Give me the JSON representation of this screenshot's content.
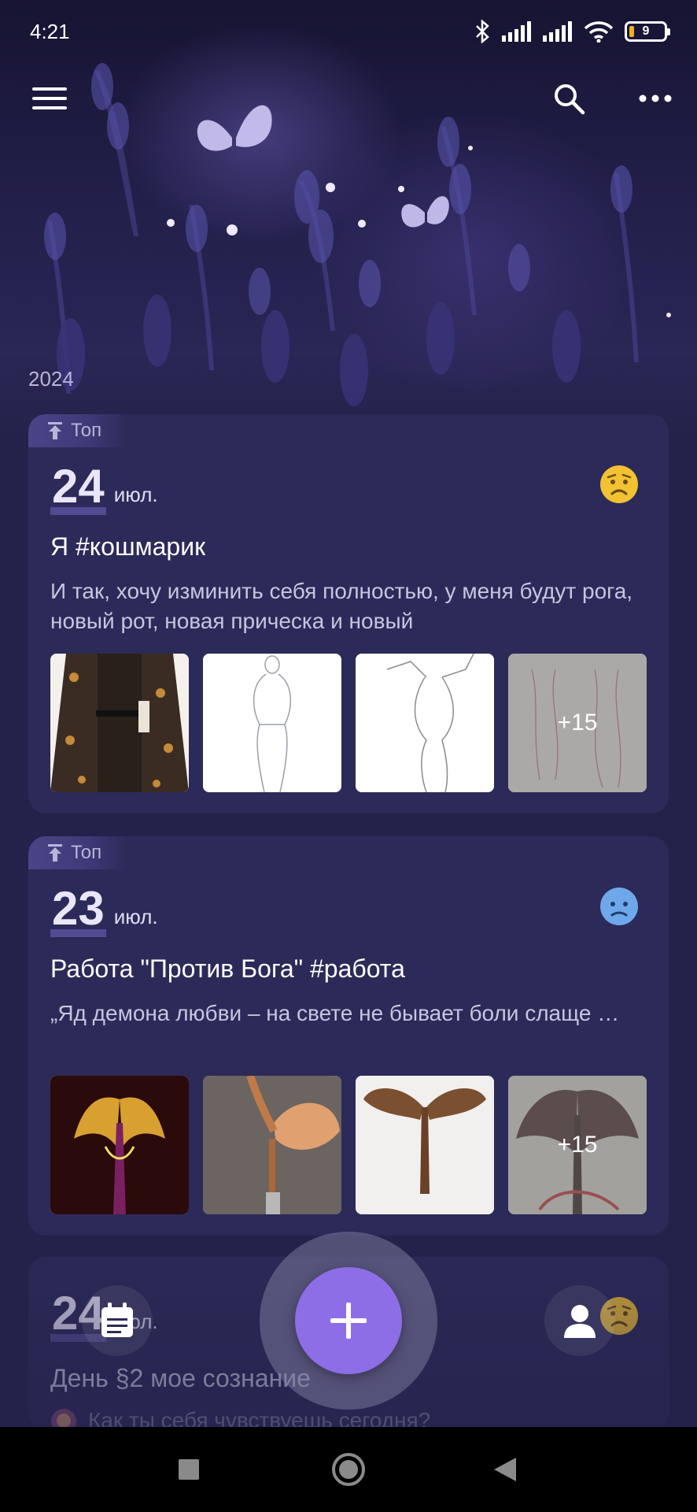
{
  "status_bar": {
    "time": "4:21",
    "battery_level": "9",
    "icons": [
      "bluetooth-icon",
      "signal-icon",
      "signal-icon",
      "wifi-icon",
      "battery-icon"
    ]
  },
  "toolbar": {
    "icons": [
      "menu-icon",
      "search-icon",
      "more-icon"
    ]
  },
  "timeline": {
    "year": "2024",
    "entries": [
      {
        "tag": "Топ",
        "day": "24",
        "month": "июл.",
        "mood": "sad-face-icon",
        "mood_color": "#f2c233",
        "title": "Я #кошмарик",
        "body": "И так, хочу изминить себя  полностью, у меня будут рога, новый рот, новая прическа и новый",
        "more": "+15"
      },
      {
        "tag": "Топ",
        "day": "23",
        "month": "июл.",
        "mood": "worried-face-icon",
        "mood_color": "#6ea8ea",
        "title": "Работа \"Против Бога\" #работа",
        "body": "„Яд демона любви – на свете не бывает боли слаще …",
        "more": "+15"
      },
      {
        "day": "24",
        "month": "июл.",
        "mood": "sad-face-icon",
        "mood_color": "#f2c233",
        "title": "День §2 мое сознание",
        "prompt": "Как ты себя чувствуешь сегодня?"
      }
    ]
  },
  "colors": {
    "background": "#24224a",
    "card": "#2c2a58",
    "accent": "#8d6ee6"
  },
  "bottom_nav": {
    "icons": [
      "diary-icon",
      "add-icon",
      "profile-icon"
    ]
  },
  "system_nav": {
    "icons": [
      "recents-icon",
      "home-icon",
      "back-icon"
    ]
  }
}
